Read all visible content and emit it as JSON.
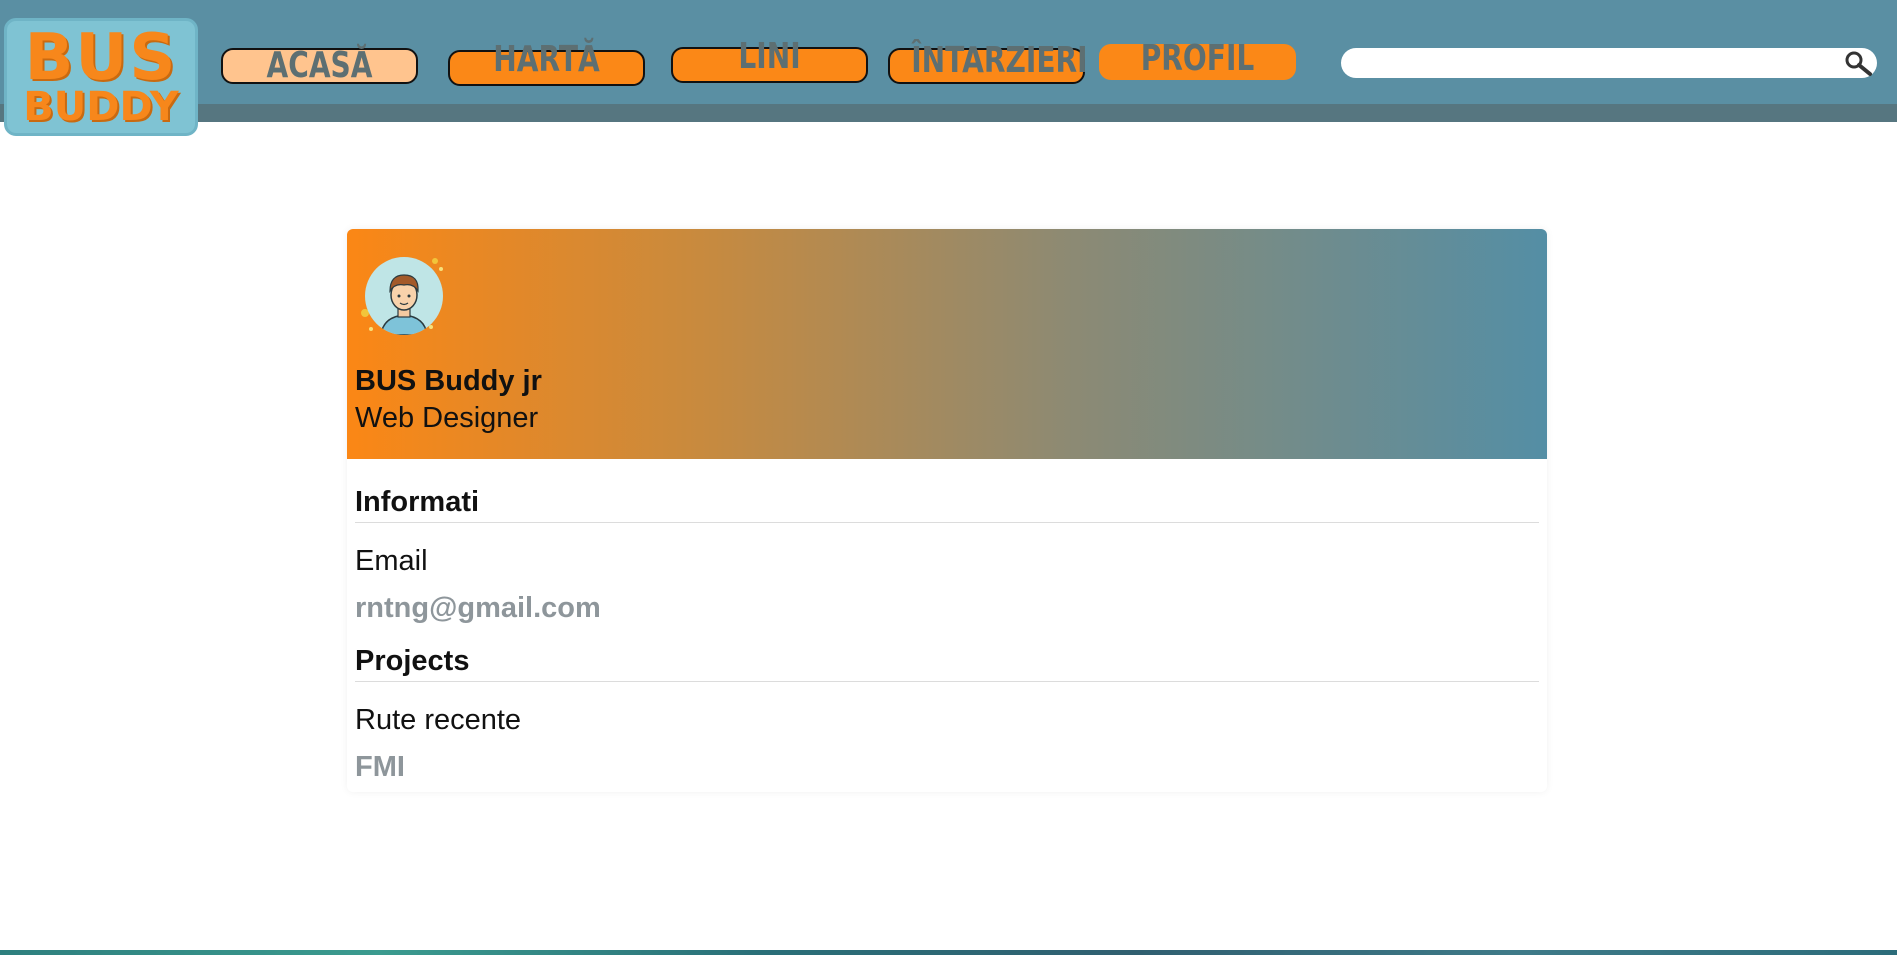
{
  "logo": {
    "line1": "BUS",
    "line2": "BUDDY"
  },
  "nav": {
    "items": [
      {
        "label": "ACASĂ"
      },
      {
        "label": "HARTĂ"
      },
      {
        "label": "LINI"
      },
      {
        "label": "ÎNTARZIERI"
      },
      {
        "label": "PROFIL"
      }
    ]
  },
  "search": {
    "placeholder": "",
    "icon": "search-icon"
  },
  "profile": {
    "avatar_icon": "user-avatar",
    "name": "BUS Buddy jr",
    "role": "Web Designer",
    "info_title": "Informati",
    "email_label": "Email",
    "email_value": "rntng@gmail.com",
    "projects_title": "Projects",
    "routes_label": "Rute recente",
    "routes_value": "FMI"
  },
  "colors": {
    "header": "#5a8fa3",
    "accent_orange": "#fb8817",
    "light_orange": "#ffc48e",
    "nav_text": "#5d6f72",
    "muted_value": "#8e969b"
  }
}
